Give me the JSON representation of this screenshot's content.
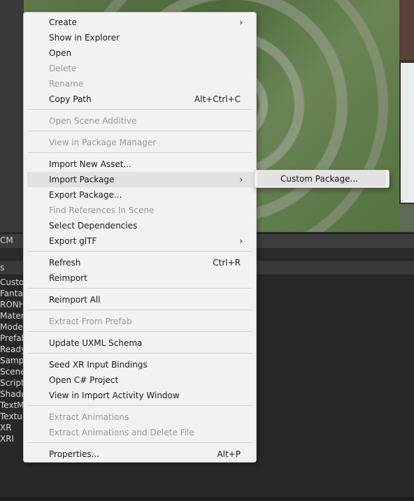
{
  "console_tab": "CM",
  "project_header": "s",
  "folders": [
    "Custom",
    "Fantas",
    "RONH",
    "Materia",
    "Models",
    "Prefab",
    "Ready",
    "Sample",
    "Scenes",
    "Scripts",
    "Shader",
    "TextMe",
    "Texture",
    "XR",
    "XRI"
  ],
  "menu": {
    "create": "Create",
    "show_in_explorer": "Show in Explorer",
    "open": "Open",
    "delete": "Delete",
    "rename": "Rename",
    "copy_path": "Copy Path",
    "copy_path_shortcut": "Alt+Ctrl+C",
    "open_scene_additive": "Open Scene Additive",
    "view_in_package_manager": "View in Package Manager",
    "import_new_asset": "Import New Asset...",
    "import_package": "Import Package",
    "export_package": "Export Package...",
    "find_references": "Find References In Scene",
    "select_dependencies": "Select Dependencies",
    "export_gltf": "Export glTF",
    "refresh": "Refresh",
    "refresh_shortcut": "Ctrl+R",
    "reimport": "Reimport",
    "reimport_all": "Reimport All",
    "extract_from_prefab": "Extract From Prefab",
    "update_uxml": "Update UXML Schema",
    "seed_xr": "Seed XR Input Bindings",
    "open_csharp": "Open C# Project",
    "view_import_activity": "View in Import Activity Window",
    "extract_animations": "Extract Animations",
    "extract_animations_delete": "Extract Animations and Delete File",
    "properties": "Properties...",
    "properties_shortcut": "Alt+P",
    "submenu_arrow": "›"
  },
  "submenu": {
    "custom_package": "Custom Package..."
  }
}
